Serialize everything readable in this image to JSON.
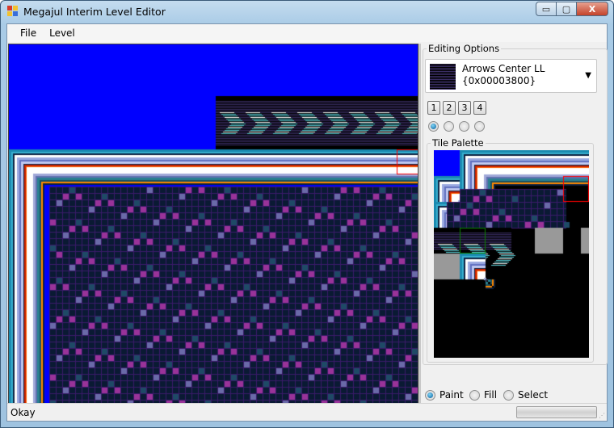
{
  "window": {
    "title": "Megajul Interim Level Editor",
    "minimize": "▭",
    "maximize": "▢",
    "close": "X"
  },
  "menu": {
    "items": [
      {
        "label": "File"
      },
      {
        "label": "Level"
      }
    ]
  },
  "editing_options": {
    "group_label": "Editing Options",
    "tile_select": {
      "name": "Arrows Center LL",
      "code": "{0x00003800}"
    },
    "layer_buttons": [
      "1",
      "2",
      "3",
      "4"
    ],
    "layer_radio_selected": 0,
    "tile_palette_label": "Tile Palette"
  },
  "tools": {
    "options": [
      "Paint",
      "Fill",
      "Select"
    ],
    "selected": "Paint"
  },
  "status": {
    "text": "Okay",
    "progress": 0
  }
}
